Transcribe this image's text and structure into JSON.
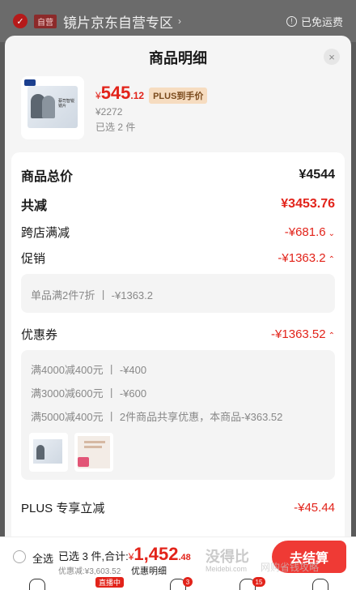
{
  "store": {
    "tag": "自营",
    "name": "镜片京东自营专区",
    "freeship": "已免运费"
  },
  "sheet": {
    "title": "商品明细",
    "close": "×"
  },
  "product": {
    "price_cur": "¥",
    "price_int": "545",
    "price_dec": ".12",
    "plus_tag": "PLUS到手价",
    "orig_price": "¥2272",
    "selected": "已选 2 件",
    "thumb_text": "蔡司智锐 镜片"
  },
  "summary": {
    "total_label": "商品总价",
    "total_value": "¥4544",
    "reduce_label": "共减",
    "reduce_value": "¥3453.76",
    "cross_label": "跨店满减",
    "cross_value": "-¥681.6",
    "promo_label": "促销",
    "promo_value": "-¥1363.2",
    "promo_detail": "单品满2件7折 丨 -¥1363.2",
    "coupon_label": "优惠券",
    "coupon_value": "-¥1363.52",
    "coupon_lines": [
      "满4000减400元 丨 -¥400",
      "满3000减600元 丨 -¥600",
      "满5000减400元 丨 2件商品共享优惠，本商品-¥363.52"
    ],
    "plus_label": "PLUS 专享立减",
    "plus_value": "-¥45.44"
  },
  "bottom": {
    "select_all": "全选",
    "sum_label": "已选 3 件,合计:",
    "sum_cur": "¥",
    "sum_int": "1,452",
    "sum_dec": ".48",
    "discount_line": "优惠减:¥3,603.52",
    "detail_link": "优惠明细",
    "checkout": "去结算",
    "watermark": "没得比",
    "watermark_sub": "Meidebi.com",
    "watermark2": "网购省钱攻略"
  },
  "tabbar": {
    "live": "直播中",
    "badge_msg": "3",
    "badge_cart": "15"
  },
  "colors": {
    "accent": "#e2231a",
    "checkout": "#ef3a35"
  }
}
